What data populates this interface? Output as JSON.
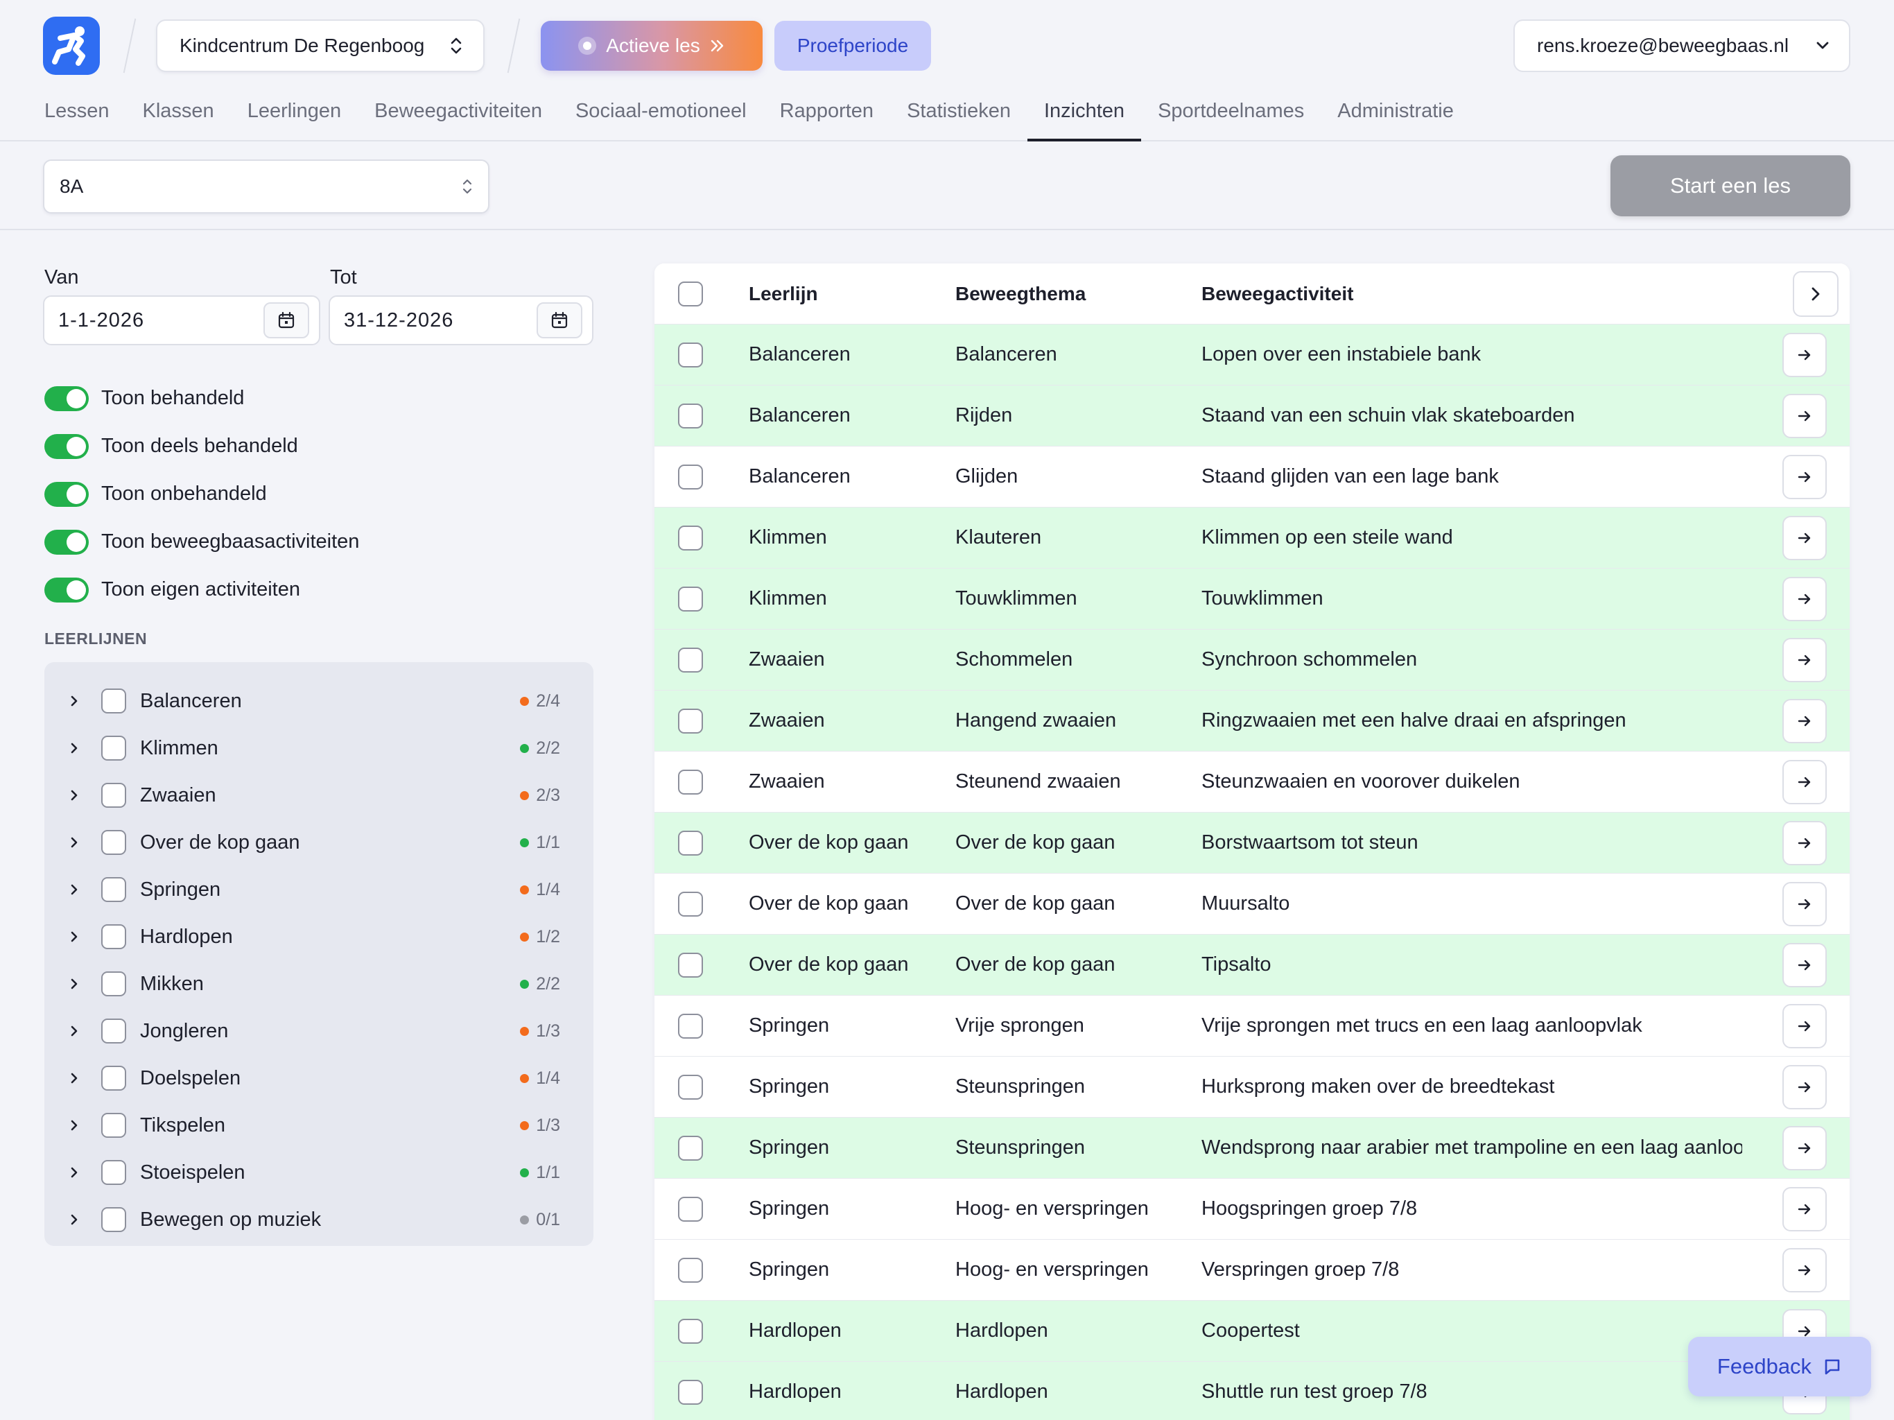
{
  "header": {
    "school": "Kindcentrum De Regenboog",
    "active_lesson": "Actieve les",
    "trial": "Proefperiode",
    "account": "rens.kroeze@beweegbaas.nl"
  },
  "nav": [
    {
      "label": "Lessen"
    },
    {
      "label": "Klassen"
    },
    {
      "label": "Leerlingen"
    },
    {
      "label": "Beweegactiviteiten"
    },
    {
      "label": "Sociaal-emotioneel"
    },
    {
      "label": "Rapporten"
    },
    {
      "label": "Statistieken"
    },
    {
      "label": "Inzichten",
      "active": true
    },
    {
      "label": "Sportdeelnames"
    },
    {
      "label": "Administratie"
    }
  ],
  "subbar": {
    "class_value": "8A",
    "start_label": "Start een les"
  },
  "filters": {
    "from_label": "Van",
    "from_value": "1-1-2026",
    "to_label": "Tot",
    "to_value": "31-12-2026",
    "toggles": [
      {
        "label": "Toon behandeld"
      },
      {
        "label": "Toon deels behandeld"
      },
      {
        "label": "Toon onbehandeld"
      },
      {
        "label": "Toon beweegbaasactiviteiten"
      },
      {
        "label": "Toon eigen activiteiten"
      }
    ]
  },
  "learning_lines": {
    "title": "LEERLIJNEN",
    "colors": {
      "orange": "#f36b1c",
      "green": "#22b04b",
      "gray": "#9b9da4"
    },
    "items": [
      {
        "name": "Balanceren",
        "count": "2/4",
        "status": "orange"
      },
      {
        "name": "Klimmen",
        "count": "2/2",
        "status": "green"
      },
      {
        "name": "Zwaaien",
        "count": "2/3",
        "status": "orange"
      },
      {
        "name": "Over de kop gaan",
        "count": "1/1",
        "status": "green"
      },
      {
        "name": "Springen",
        "count": "1/4",
        "status": "orange"
      },
      {
        "name": "Hardlopen",
        "count": "1/2",
        "status": "orange"
      },
      {
        "name": "Mikken",
        "count": "2/2",
        "status": "green"
      },
      {
        "name": "Jongleren",
        "count": "1/3",
        "status": "orange"
      },
      {
        "name": "Doelspelen",
        "count": "1/4",
        "status": "orange"
      },
      {
        "name": "Tikspelen",
        "count": "1/3",
        "status": "orange"
      },
      {
        "name": "Stoeispelen",
        "count": "1/1",
        "status": "green"
      },
      {
        "name": "Bewegen op muziek",
        "count": "0/1",
        "status": "gray"
      }
    ]
  },
  "table": {
    "columns": [
      "Leerlijn",
      "Beweegthema",
      "Beweegactiviteit"
    ],
    "rows": [
      {
        "line": "Balanceren",
        "theme": "Balanceren",
        "activity": "Lopen over een instabiele bank",
        "treated": true
      },
      {
        "line": "Balanceren",
        "theme": "Rijden",
        "activity": "Staand van een schuin vlak skateboarden",
        "treated": true
      },
      {
        "line": "Balanceren",
        "theme": "Glijden",
        "activity": "Staand glijden van een lage bank",
        "treated": false
      },
      {
        "line": "Klimmen",
        "theme": "Klauteren",
        "activity": "Klimmen op een steile wand",
        "treated": true
      },
      {
        "line": "Klimmen",
        "theme": "Touwklimmen",
        "activity": "Touwklimmen",
        "treated": true
      },
      {
        "line": "Zwaaien",
        "theme": "Schommelen",
        "activity": "Synchroon schommelen",
        "treated": true
      },
      {
        "line": "Zwaaien",
        "theme": "Hangend zwaaien",
        "activity": "Ringzwaaien met een halve draai en afspringen",
        "treated": true
      },
      {
        "line": "Zwaaien",
        "theme": "Steunend zwaaien",
        "activity": "Steunzwaaien en voorover duikelen",
        "treated": false
      },
      {
        "line": "Over de kop gaan",
        "theme": "Over de kop gaan",
        "activity": "Borstwaartsom tot steun",
        "treated": true
      },
      {
        "line": "Over de kop gaan",
        "theme": "Over de kop gaan",
        "activity": "Muursalto",
        "treated": false
      },
      {
        "line": "Over de kop gaan",
        "theme": "Over de kop gaan",
        "activity": "Tipsalto",
        "treated": true
      },
      {
        "line": "Springen",
        "theme": "Vrije sprongen",
        "activity": "Vrije sprongen met trucs en een laag aanloopvlak",
        "treated": false
      },
      {
        "line": "Springen",
        "theme": "Steunspringen",
        "activity": "Hurksprong maken over de breedtekast",
        "treated": false
      },
      {
        "line": "Springen",
        "theme": "Steunspringen",
        "activity": "Wendsprong naar arabier met trampoline en een laag aanloopvlak",
        "treated": true
      },
      {
        "line": "Springen",
        "theme": "Hoog- en verspringen",
        "activity": "Hoogspringen groep 7/8",
        "treated": false
      },
      {
        "line": "Springen",
        "theme": "Hoog- en verspringen",
        "activity": "Verspringen groep 7/8",
        "treated": false
      },
      {
        "line": "Hardlopen",
        "theme": "Hardlopen",
        "activity": "Coopertest",
        "treated": true
      },
      {
        "line": "Hardlopen",
        "theme": "Hardlopen",
        "activity": "Shuttle run test groep 7/8",
        "treated": true
      }
    ]
  },
  "feedback": "Feedback"
}
